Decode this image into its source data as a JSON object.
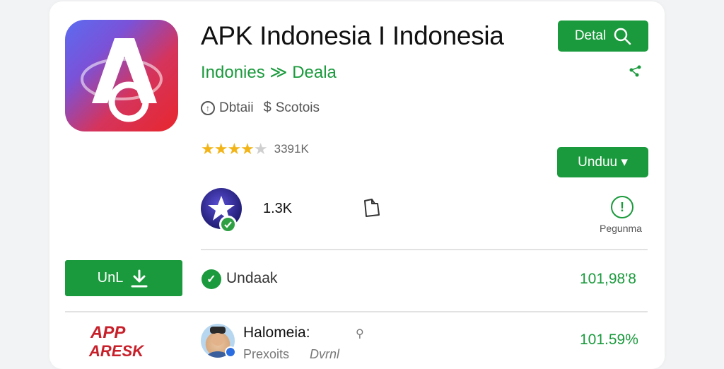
{
  "app": {
    "title": "APK Indonesia I Indonesia",
    "subtitle": "Indonies ≫ Deala",
    "meta_detail": "Dbtaii",
    "meta_scotois": "Scotois",
    "rating_stars": 3.5,
    "rating_count": "3391K"
  },
  "header_actions": {
    "detail_label": "Detal",
    "undo_label": "Unduu ▾"
  },
  "stats": {
    "downloads": "1.3K",
    "info_label": "Pegunma"
  },
  "download_row": {
    "button_label": "UnL",
    "status_label": "Undaak",
    "value": "101,98'8"
  },
  "user_row": {
    "logo_text_line1": "APP",
    "logo_text_line2": "ARESK",
    "name": "Halomeia:",
    "sub1": "Prexoits",
    "sub2": "Dvrnl",
    "value": "101.59%"
  },
  "colors": {
    "accent": "#1a9a3c",
    "star": "#f2b417",
    "title": "#111111"
  },
  "icons": {
    "detail": "search-icon",
    "share": "share-icon",
    "info": "info-icon",
    "download": "download-arrow-icon",
    "check": "check-circle-icon",
    "developer": "star-avatar-icon",
    "stat": "document-icon"
  }
}
